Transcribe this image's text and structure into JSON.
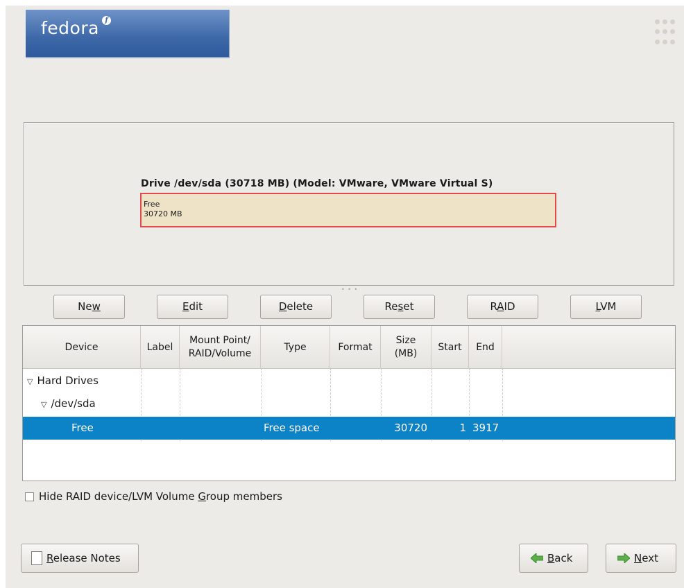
{
  "logo": {
    "text": "fedora",
    "mark": "f"
  },
  "drive": {
    "title": "Drive /dev/sda (30718 MB) (Model: VMware, VMware Virtual S)",
    "segment_label": "Free",
    "segment_size": "30720 MB"
  },
  "toolbar": {
    "new_pre": "Ne",
    "new_ul": "w",
    "new_post": "",
    "edit_pre": "",
    "edit_ul": "E",
    "edit_post": "dit",
    "delete_pre": "",
    "delete_ul": "D",
    "delete_post": "elete",
    "reset_pre": "Re",
    "reset_ul": "s",
    "reset_post": "et",
    "raid_pre": "R",
    "raid_ul": "A",
    "raid_post": "ID",
    "lvm_pre": "",
    "lvm_ul": "L",
    "lvm_post": "VM"
  },
  "table": {
    "headers": {
      "device": "Device",
      "label": "Label",
      "mount_line1": "Mount Point/",
      "mount_line2": "RAID/Volume",
      "type": "Type",
      "format": "Format",
      "size_line1": "Size",
      "size_line2": "(MB)",
      "start": "Start",
      "end": "End"
    },
    "rows": [
      {
        "device": "Hard Drives"
      },
      {
        "device": "/dev/sda"
      },
      {
        "device": "Free",
        "type": "Free space",
        "size": "30720",
        "start": "1",
        "end": "3917"
      }
    ]
  },
  "options": {
    "hide_members_pre": "Hide RAID device/LVM Volume ",
    "hide_members_ul": "G",
    "hide_members_post": "roup members",
    "hide_members_checked": false
  },
  "nav": {
    "release_notes_ul": "R",
    "release_notes_post": "elease Notes",
    "back_ul": "B",
    "back_post": "ack",
    "next_ul": "N",
    "next_post": "ext"
  },
  "colors": {
    "selection": "#0c82c7",
    "free_segment": "#eee3c6",
    "segment_border": "#e24b4b",
    "logo_blue": "#3d68a8",
    "arrow_green": "#5cb04a"
  }
}
